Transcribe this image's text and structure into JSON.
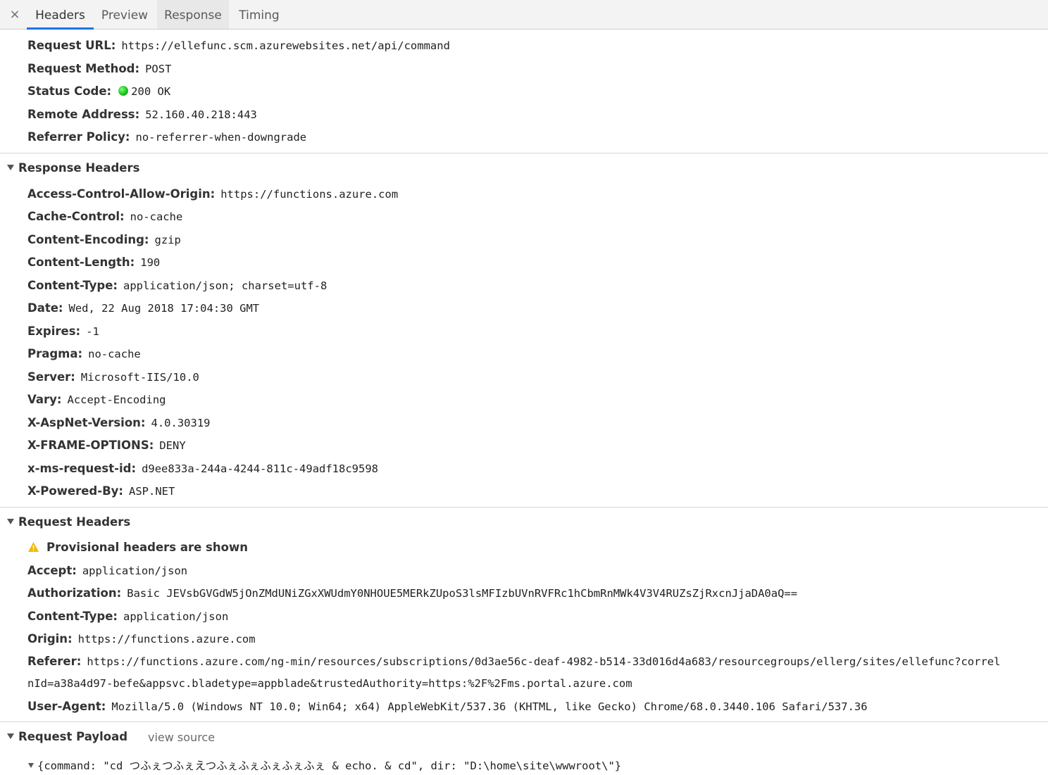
{
  "tabs": {
    "close_icon": "×",
    "items": [
      "Headers",
      "Preview",
      "Response",
      "Timing"
    ],
    "active": "Headers"
  },
  "general": {
    "request_url": {
      "key": "Request URL:",
      "value": "https://ellefunc.scm.azurewebsites.net/api/command"
    },
    "request_method": {
      "key": "Request Method:",
      "value": "POST"
    },
    "status_code": {
      "key": "Status Code:",
      "value": "200 OK",
      "status_color": "#1fc21f"
    },
    "remote_address": {
      "key": "Remote Address:",
      "value": "52.160.40.218:443"
    },
    "referrer_policy": {
      "key": "Referrer Policy:",
      "value": "no-referrer-when-downgrade"
    }
  },
  "response_headers": {
    "title": "Response Headers",
    "items": [
      {
        "key": "Access-Control-Allow-Origin:",
        "value": "https://functions.azure.com"
      },
      {
        "key": "Cache-Control:",
        "value": "no-cache"
      },
      {
        "key": "Content-Encoding:",
        "value": "gzip"
      },
      {
        "key": "Content-Length:",
        "value": "190"
      },
      {
        "key": "Content-Type:",
        "value": "application/json; charset=utf-8"
      },
      {
        "key": "Date:",
        "value": "Wed, 22 Aug 2018 17:04:30 GMT"
      },
      {
        "key": "Expires:",
        "value": "-1"
      },
      {
        "key": "Pragma:",
        "value": "no-cache"
      },
      {
        "key": "Server:",
        "value": "Microsoft-IIS/10.0"
      },
      {
        "key": "Vary:",
        "value": "Accept-Encoding"
      },
      {
        "key": "X-AspNet-Version:",
        "value": "4.0.30319"
      },
      {
        "key": "X-FRAME-OPTIONS:",
        "value": "DENY"
      },
      {
        "key": "x-ms-request-id:",
        "value": "d9ee833a-244a-4244-811c-49adf18c9598"
      },
      {
        "key": "X-Powered-By:",
        "value": "ASP.NET"
      }
    ]
  },
  "request_headers": {
    "title": "Request Headers",
    "warning": "Provisional headers are shown",
    "accept": {
      "key": "Accept:",
      "value": "application/json"
    },
    "authorization": {
      "key": "Authorization:",
      "value": "Basic JEVsbGVGdW5jOnZMdUNiZGxXWUdmY0NHOUE5MERkZUpoS3lsMFIzbUVnRVFRc1hCbmRnMWk4V3V4RUZsZjRxcnJjaDA0aQ=="
    },
    "content_type": {
      "key": "Content-Type:",
      "value": "application/json"
    },
    "origin": {
      "key": "Origin:",
      "value": "https://functions.azure.com"
    },
    "referer": {
      "key": "Referer:",
      "value_line1": "https://functions.azure.com/ng-min/resources/subscriptions/0d3ae56c-deaf-4982-b514-33d016d4a683/resourcegroups/ellerg/sites/ellefunc?correl",
      "value_line2": "nId=a38a4d97-befe&appsvc.bladetype=appblade&trustedAuthority=https:%2F%2Fms.portal.azure.com"
    },
    "user_agent": {
      "key": "User-Agent:",
      "value": "Mozilla/5.0 (Windows NT 10.0; Win64; x64) AppleWebKit/537.36 (KHTML, like Gecko) Chrome/68.0.3440.106 Safari/537.36"
    }
  },
  "request_payload": {
    "title": "Request Payload",
    "view_source": "view source",
    "body": "{command: \"cd つふぇつふぇえつふぇふぇふぇふぇふぇ & echo. & cd\", dir: \"D:\\home\\site\\wwwroot\\\"}"
  },
  "icons": {
    "close": "close-icon",
    "status": "status-dot-icon",
    "warning": "warning-icon",
    "expand": "triangle-down-icon"
  },
  "colors": {
    "active_tab_underline": "#1a73e8",
    "warning": "#f2b900"
  }
}
